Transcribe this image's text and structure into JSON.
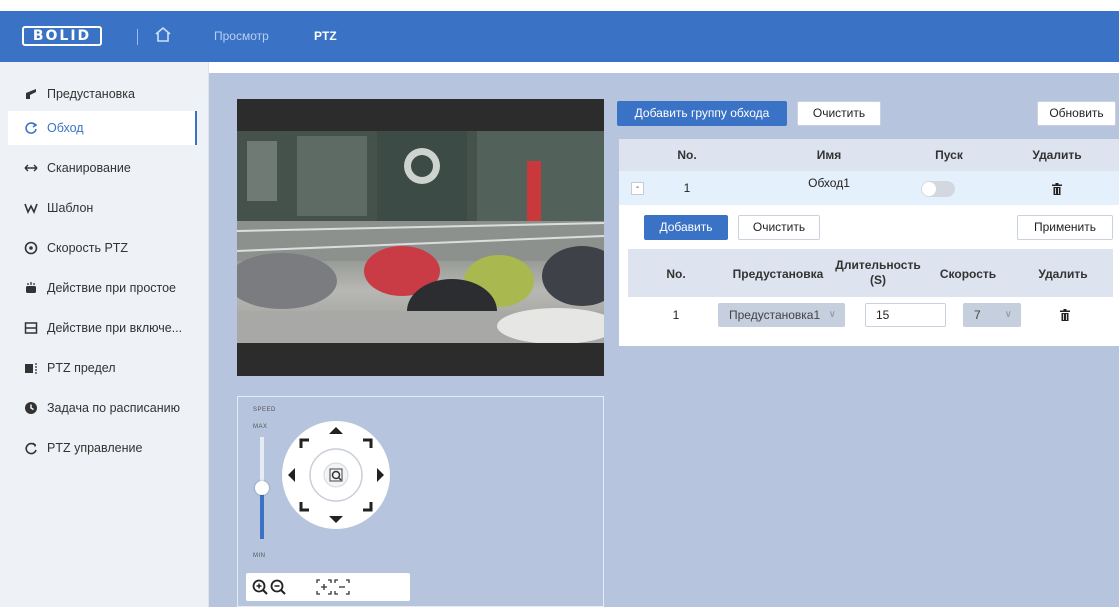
{
  "header": {
    "logo": "BOLID",
    "nav": [
      {
        "label": "Просмотр"
      },
      {
        "label": "PTZ"
      }
    ]
  },
  "sidebar": {
    "items": [
      {
        "label": "Предустановка",
        "icon": "preset-icon"
      },
      {
        "label": "Обход",
        "icon": "tour-icon",
        "active": true
      },
      {
        "label": "Сканирование",
        "icon": "scan-icon"
      },
      {
        "label": "Шаблон",
        "icon": "pattern-icon"
      },
      {
        "label": "Скорость PTZ",
        "icon": "speed-icon"
      },
      {
        "label": "Действие при простое",
        "icon": "idle-icon"
      },
      {
        "label": "Действие при включе...",
        "icon": "power-up-icon"
      },
      {
        "label": "PTZ предел",
        "icon": "limit-icon"
      },
      {
        "label": "Задача по расписанию",
        "icon": "schedule-icon"
      },
      {
        "label": "PTZ управление",
        "icon": "control-icon"
      }
    ]
  },
  "ptz_control": {
    "speed_label": "SPEED",
    "max_label": "MAX",
    "min_label": "MIN",
    "speed_level": 0.5
  },
  "tour": {
    "add_group_label": "Добавить группу обхода",
    "clear_label": "Очистить",
    "refresh_label": "Обновить",
    "columns": [
      "No.",
      "Имя",
      "Пуск",
      "Удалить"
    ],
    "rows": [
      {
        "no": "1",
        "name": "Обход1",
        "running": false,
        "collapse": "-"
      }
    ]
  },
  "tour_points": {
    "add_label": "Добавить",
    "clear_label": "Очистить",
    "apply_label": "Применить",
    "columns": [
      "No.",
      "Предустановка",
      "Длительность\n(S)",
      "Скорость",
      "Удалить"
    ],
    "rows": [
      {
        "no": "1",
        "preset": "Предустановка1",
        "duration": "15",
        "speed": "7"
      }
    ]
  },
  "colors": {
    "accent": "#3a73c6",
    "panel_bg": "#b6c4dd",
    "sidebar_bg": "#eef1f5"
  }
}
